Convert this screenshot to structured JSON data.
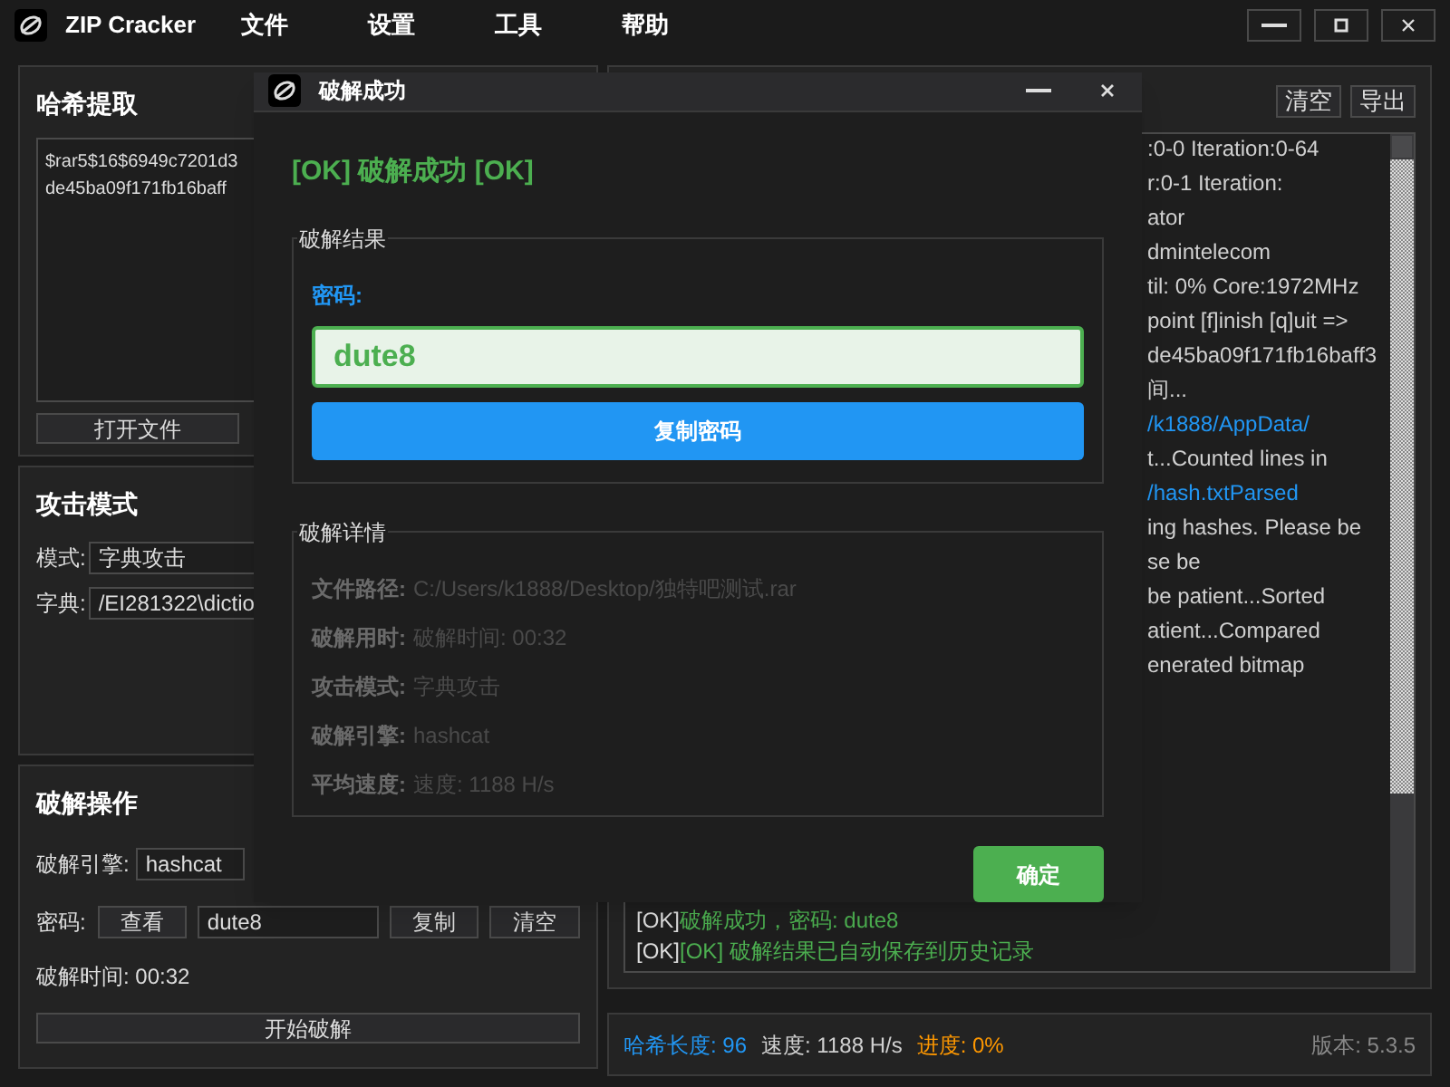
{
  "app": {
    "title": "ZIP Cracker",
    "menu": [
      "文件",
      "设置",
      "工具",
      "帮助"
    ],
    "window_buttons": [
      {
        "kind": "minimize"
      },
      {
        "kind": "maximize"
      },
      {
        "kind": "close"
      }
    ]
  },
  "hash_panel": {
    "title": "哈希提取",
    "hash_lines": [
      "$rar5$16$6949c7201d3",
      "de45ba09f171fb16baff"
    ],
    "open_button": "打开文件"
  },
  "attack_panel": {
    "title": "攻击模式",
    "mode_label": "模式:",
    "mode_value": "字典攻击",
    "dict_label": "字典:",
    "dict_value": "/EI281322\\dictio"
  },
  "ops_panel": {
    "title": "破解操作",
    "engine_label": "破解引擎:",
    "engine_value": "hashcat",
    "password_label": "密码:",
    "view_button": "查看",
    "password_value": "dute8",
    "copy_button": "复制",
    "clear_button": "清空",
    "time": "破解时间: 00:32",
    "start_button": "开始破解"
  },
  "log_panel": {
    "buttons": [
      "清空",
      "导出"
    ],
    "lines": [
      {
        "text": ":0-0 Iteration:0-64",
        "kind": "text"
      },
      {
        "text": "r:0-1 Iteration:",
        "kind": "text"
      },
      {
        "text": "ator",
        "kind": "text"
      },
      {
        "text": "dmintelecom",
        "kind": "text"
      },
      {
        "text": "til: 0% Core:1972MHz",
        "kind": "text"
      },
      {
        "text": "point [f]inish [q]uit =>",
        "kind": "text"
      },
      {
        "text": "de45ba09f171fb16baff3",
        "kind": "text"
      },
      {
        "text": "间...",
        "kind": "text"
      },
      {
        "text": "/k1888/AppData/",
        "kind": "path"
      },
      {
        "text": "t...Counted lines in",
        "kind": "text"
      },
      {
        "text": "/hash.txtParsed",
        "kind": "path"
      },
      {
        "text": "ing hashes. Please be",
        "kind": "text"
      },
      {
        "text": "se be",
        "kind": "text"
      },
      {
        "text": "be patient...Sorted",
        "kind": "text"
      },
      {
        "text": "atient...Compared",
        "kind": "text"
      },
      {
        "text": "enerated bitmap",
        "kind": "text"
      }
    ],
    "result_lines": [
      {
        "tag": "[OK]",
        "message": "破解成功，密码: dute8"
      },
      {
        "tag": "[OK]",
        "message": "[OK] 破解结果已自动保存到历史记录"
      }
    ]
  },
  "status_bar": {
    "items": [
      {
        "text": "哈希长度: 96",
        "color": "#2196f3"
      },
      {
        "text": "速度: 1188 H/s",
        "color": "#d0d0d0"
      },
      {
        "text": "进度: 0%",
        "color": "#ff9800"
      }
    ],
    "version": "版本: 5.3.5"
  },
  "dialog": {
    "title": "破解成功",
    "headline": "[OK] 破解成功 [OK]",
    "result_group": "破解结果",
    "password_label": "密码:",
    "password": "dute8",
    "copy_button": "复制密码",
    "details_group": "破解详情",
    "details": [
      {
        "label": "文件路径:",
        "value": "C:/Users/k1888/Desktop/独特吧测试.rar"
      },
      {
        "label": "破解用时:",
        "value": "破解时间: 00:32"
      },
      {
        "label": "攻击模式:",
        "value": "字典攻击"
      },
      {
        "label": "破解引擎:",
        "value": "hashcat"
      },
      {
        "label": "平均速度:",
        "value": "速度: 1188 H/s"
      }
    ],
    "ok_button": "确定"
  }
}
